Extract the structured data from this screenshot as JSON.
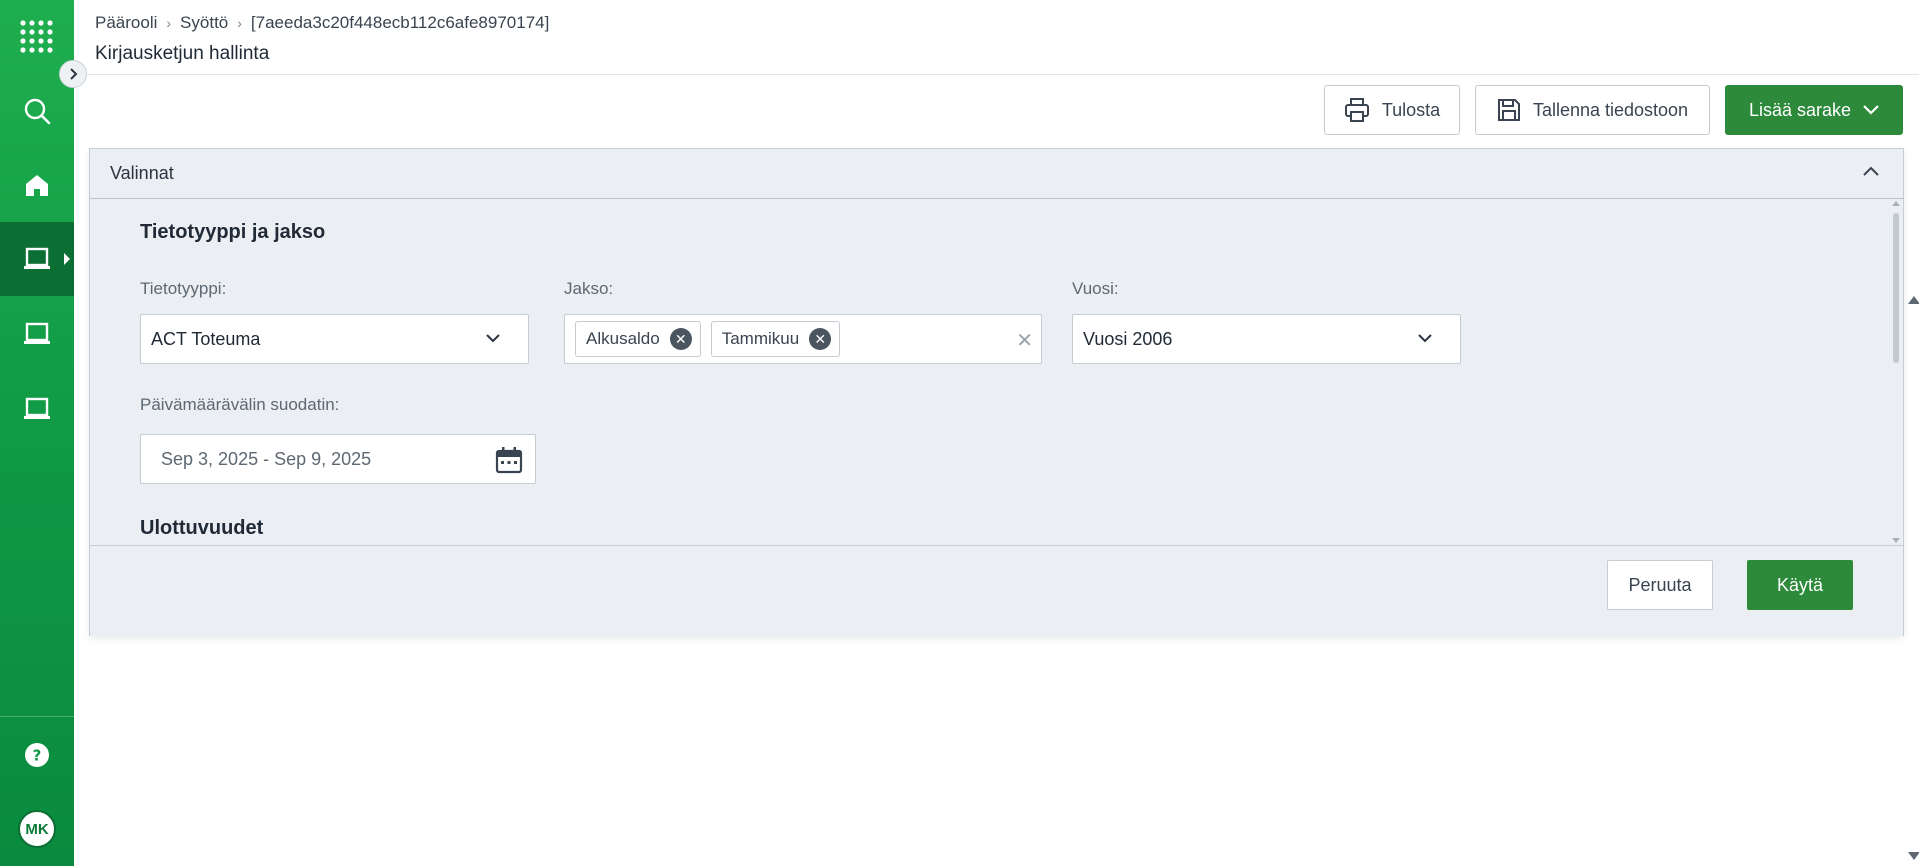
{
  "colors": {
    "accent": "#2c8a3a",
    "sidebar": "#0f9a45",
    "sidebar_active": "#0b6e33"
  },
  "sidebar": {
    "items": [
      {
        "icon": "apps-grid-icon"
      },
      {
        "icon": "search-icon"
      },
      {
        "icon": "home-icon"
      },
      {
        "icon": "laptop-icon",
        "active": true
      },
      {
        "icon": "laptop-icon"
      },
      {
        "icon": "laptop-icon"
      }
    ],
    "help_icon": "help-icon",
    "avatar_initials": "MK"
  },
  "header": {
    "breadcrumb": [
      "Päärooli",
      "Syöttö",
      "[7aeeda3c20f448ecb112c6afe8970174]"
    ],
    "title": "Kirjausketjun hallinta"
  },
  "toolbar": {
    "print_label": "Tulosta",
    "save_label": "Tallenna tiedostoon",
    "add_column_label": "Lisää sarake"
  },
  "panel": {
    "title": "Valinnat",
    "section1_title": "Tietotyyppi ja jakso",
    "data_type": {
      "label": "Tietotyyppi:",
      "value": "ACT Toteuma"
    },
    "period": {
      "label": "Jakso:",
      "chips": [
        "Alkusaldo",
        "Tammikuu"
      ]
    },
    "year": {
      "label": "Vuosi:",
      "value": "Vuosi 2006"
    },
    "date_filter": {
      "label": "Päivämäärävälin suodatin:",
      "value": "Sep 3, 2025 - Sep 9, 2025"
    },
    "section2_title": "Ulottuvuudet",
    "cancel_label": "Peruuta",
    "apply_label": "Käytä"
  }
}
